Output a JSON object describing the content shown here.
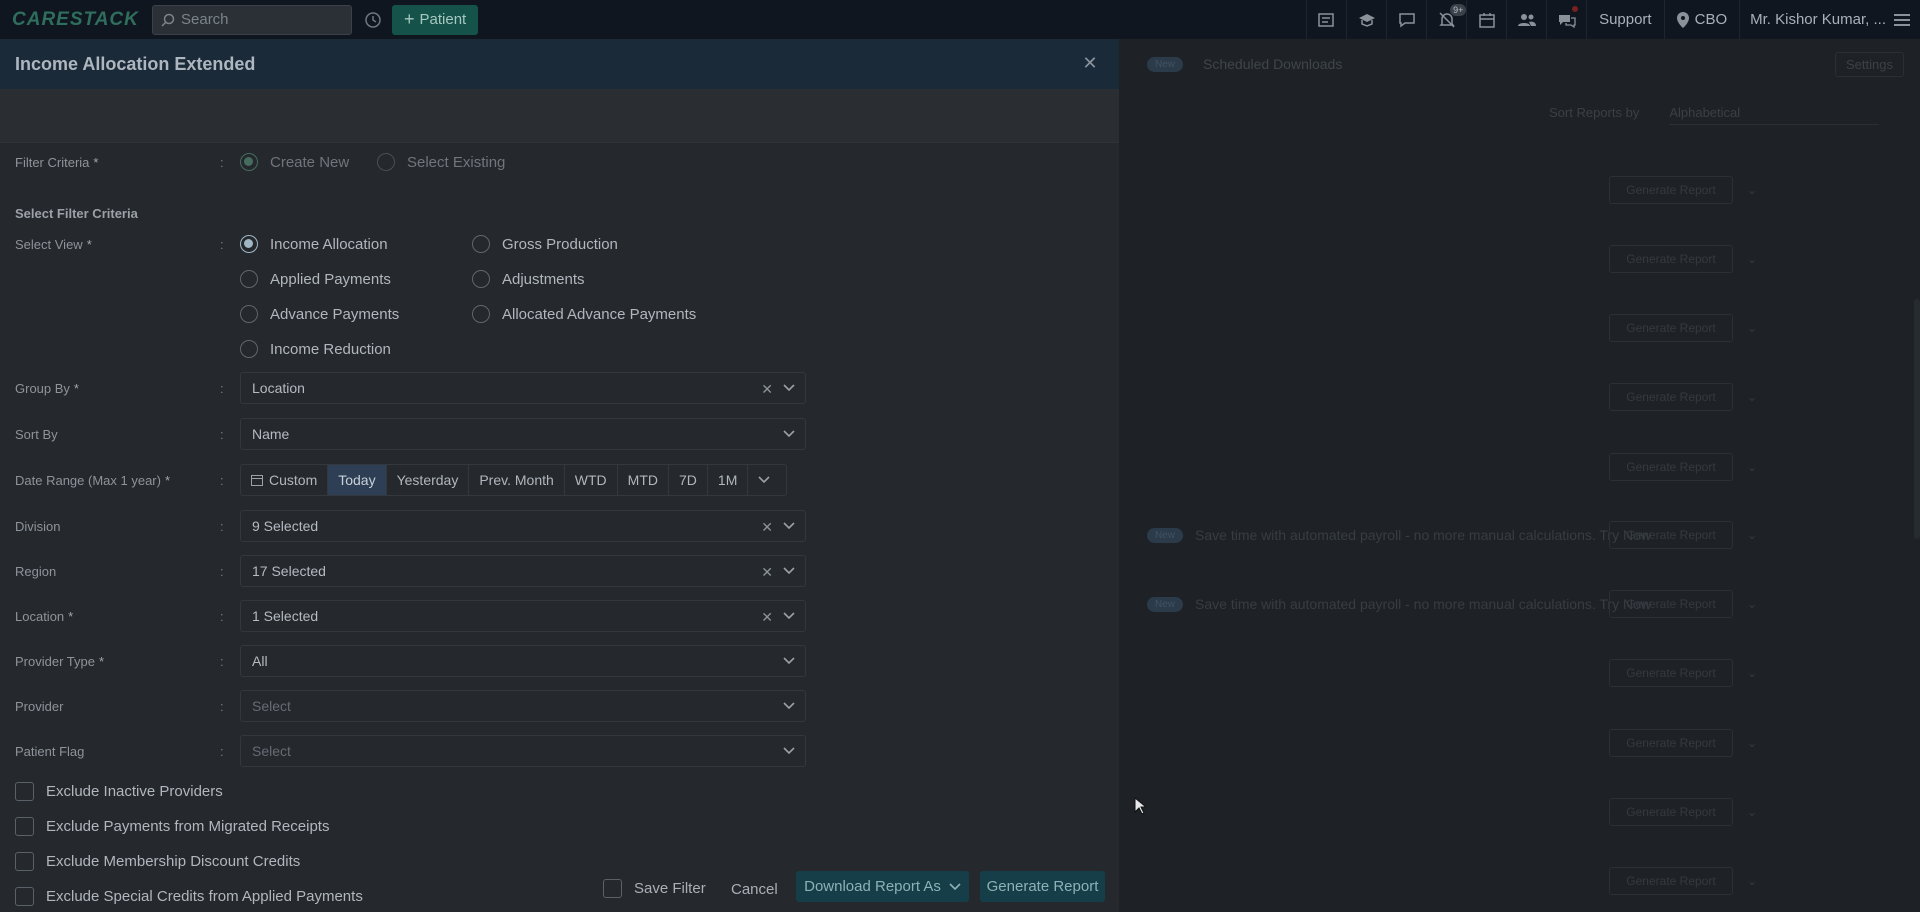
{
  "topbar": {
    "logo": "CARESTACK",
    "search_placeholder": "Search",
    "patient_label": "Patient",
    "notification_badge": "9+",
    "support_label": "Support",
    "location_label": "CBO",
    "user_name": "Mr. Kishor Kumar, ..."
  },
  "modal": {
    "title": "Income Allocation Extended",
    "filter_criteria": {
      "label": "Filter Criteria",
      "options": [
        "Create New",
        "Select Existing"
      ],
      "selected": "Create New"
    },
    "section_title": "Select Filter Criteria",
    "select_view": {
      "label": "Select View",
      "options": [
        "Income Allocation",
        "Gross Production",
        "Applied Payments",
        "Adjustments",
        "Advance Payments",
        "Allocated Advance Payments",
        "Income Reduction"
      ],
      "selected": "Income Allocation"
    },
    "group_by": {
      "label": "Group By",
      "value": "Location"
    },
    "sort_by": {
      "label": "Sort By",
      "value": "Name"
    },
    "date_range": {
      "label": "Date Range (Max 1 year)",
      "options": [
        "Custom",
        "Today",
        "Yesterday",
        "Prev. Month",
        "WTD",
        "MTD",
        "7D",
        "1M"
      ],
      "selected": "Today"
    },
    "division": {
      "label": "Division",
      "value": "9 Selected"
    },
    "region": {
      "label": "Region",
      "value": "17 Selected"
    },
    "location": {
      "label": "Location",
      "value": "1 Selected"
    },
    "provider_type": {
      "label": "Provider Type",
      "value": "All"
    },
    "provider": {
      "label": "Provider",
      "placeholder": "Select"
    },
    "patient_flag": {
      "label": "Patient Flag",
      "placeholder": "Select"
    },
    "checkboxes": [
      "Exclude Inactive Providers",
      "Exclude Payments from Migrated Receipts",
      "Exclude Membership Discount Credits",
      "Exclude Special Credits from Applied Payments"
    ],
    "footer": {
      "save_filter": "Save Filter",
      "cancel": "Cancel",
      "download": "Download Report As",
      "generate": "Generate Report"
    }
  },
  "background": {
    "tab_pill": "New",
    "tab_label": "Scheduled Downloads",
    "settings_label": "Settings",
    "sort_label": "Sort Reports by",
    "sort_value": "Alphabetical",
    "note_pill": "New",
    "promo_text": "Save time with automated payroll - no more manual calculations. Try Now",
    "report_button": "Generate Report"
  },
  "colors": {
    "accent": "#14524a",
    "modal_header": "#1b2a38",
    "active_segment": "#2d3e55"
  }
}
